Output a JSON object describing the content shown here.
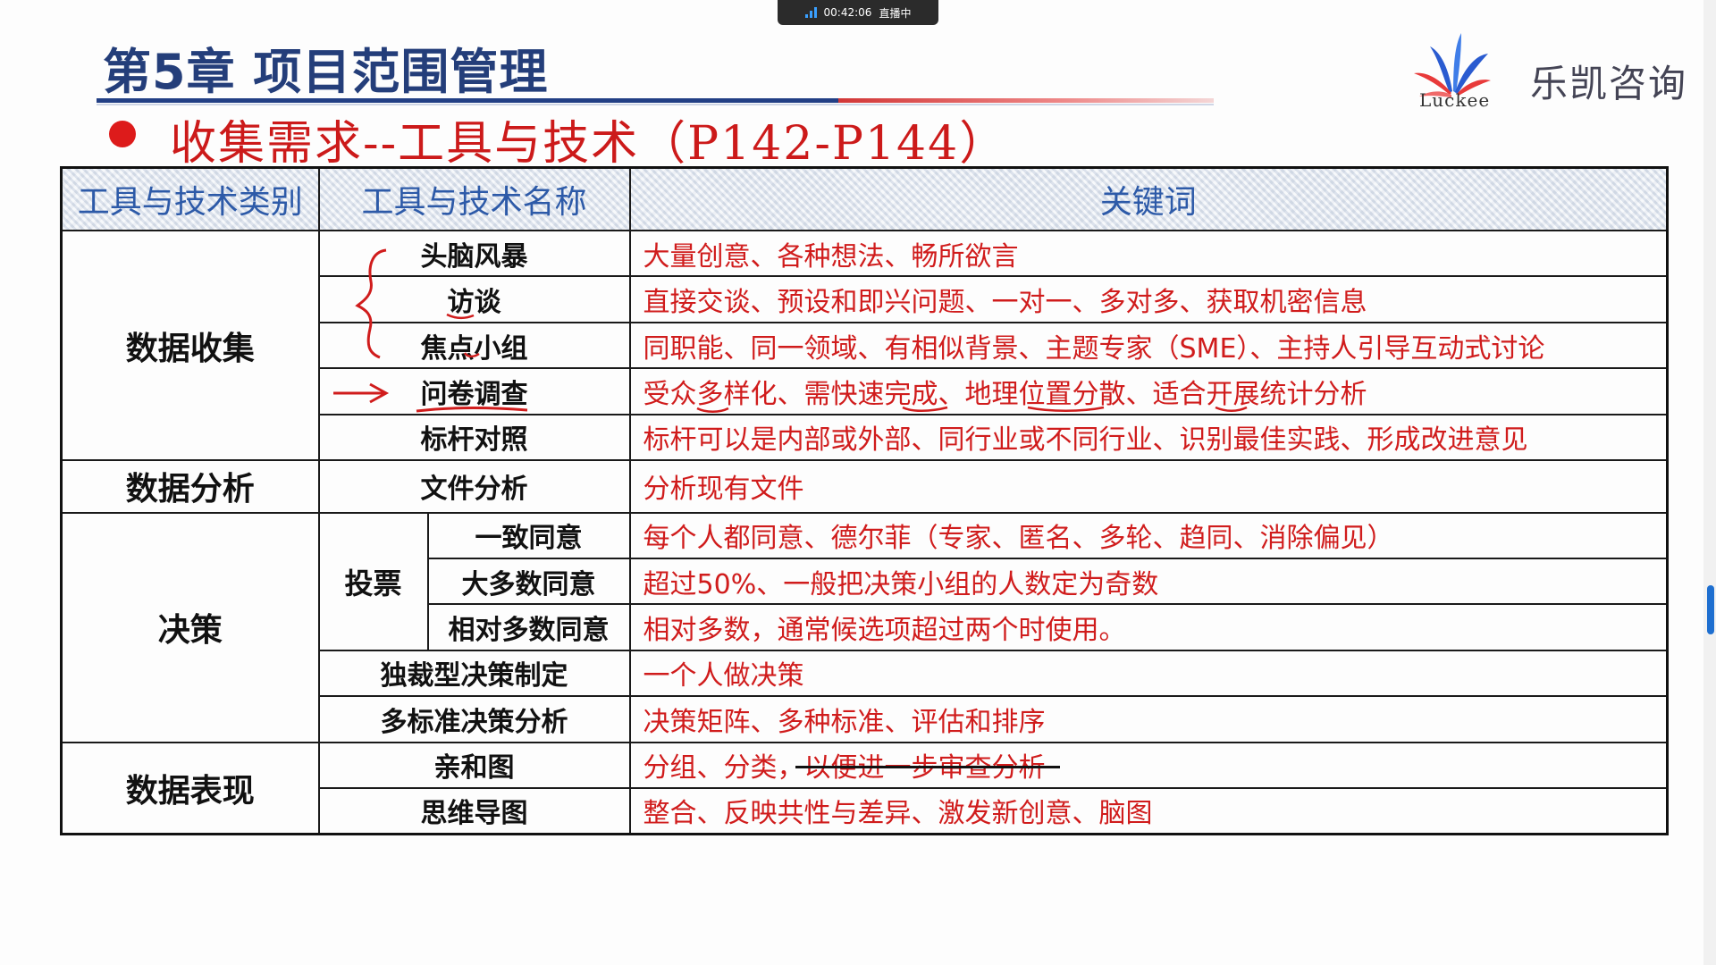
{
  "status_bar": {
    "timer": "00:42:06",
    "live_label": "直播中"
  },
  "header": {
    "chapter_title": "第5章 项目范围管理",
    "section_title": "收集需求--工具与技术（P142-P144）"
  },
  "logo": {
    "latin": "Luckee",
    "name": "乐凯咨询"
  },
  "table": {
    "headers": [
      "工具与技术类别",
      "工具与技术名称",
      "关键词"
    ],
    "categories": {
      "collect": "数据收集",
      "analysis": "数据分析",
      "decision": "决策",
      "representation": "数据表现"
    },
    "voting_label": "投票",
    "rows": [
      {
        "tool": "头脑风暴",
        "keywords": "大量创意、各种想法、畅所欲言"
      },
      {
        "tool": "访谈",
        "keywords": "直接交谈、预设和即兴问题、一对一、多对多、获取机密信息"
      },
      {
        "tool": "焦点小组",
        "keywords": "同职能、同一领域、有相似背景、主题专家（SME）、主持人引导互动式讨论"
      },
      {
        "tool": "问卷调查",
        "keywords": "受众多样化、需快速完成、地理位置分散、适合开展统计分析"
      },
      {
        "tool": "标杆对照",
        "keywords": "标杆可以是内部或外部、同行业或不同行业、识别最佳实践、形成改进意见"
      },
      {
        "tool": "文件分析",
        "keywords": "分析现有文件"
      },
      {
        "tool": "一致同意",
        "keywords": "每个人都同意、德尔菲（专家、匿名、多轮、趋同、消除偏见）"
      },
      {
        "tool": "大多数同意",
        "keywords": "超过50%、一般把决策小组的人数定为奇数"
      },
      {
        "tool": "相对多数同意",
        "keywords": "相对多数，通常候选项超过两个时使用。"
      },
      {
        "tool": "独裁型决策制定",
        "keywords": "一个人做决策"
      },
      {
        "tool": "多标准决策分析",
        "keywords": "决策矩阵、多种标准、评估和排序"
      },
      {
        "tool": "亲和图",
        "keywords": "分组、分类，以便进一步审查分析"
      },
      {
        "tool": "思维导图",
        "keywords": "整合、反映共性与差异、激发新创意、脑图"
      }
    ]
  },
  "colors": {
    "title_blue": "#243e7a",
    "header_text": "#2d5aa8",
    "keyword_red": "#d01c1c",
    "bullet_red": "#dd1b1b"
  }
}
